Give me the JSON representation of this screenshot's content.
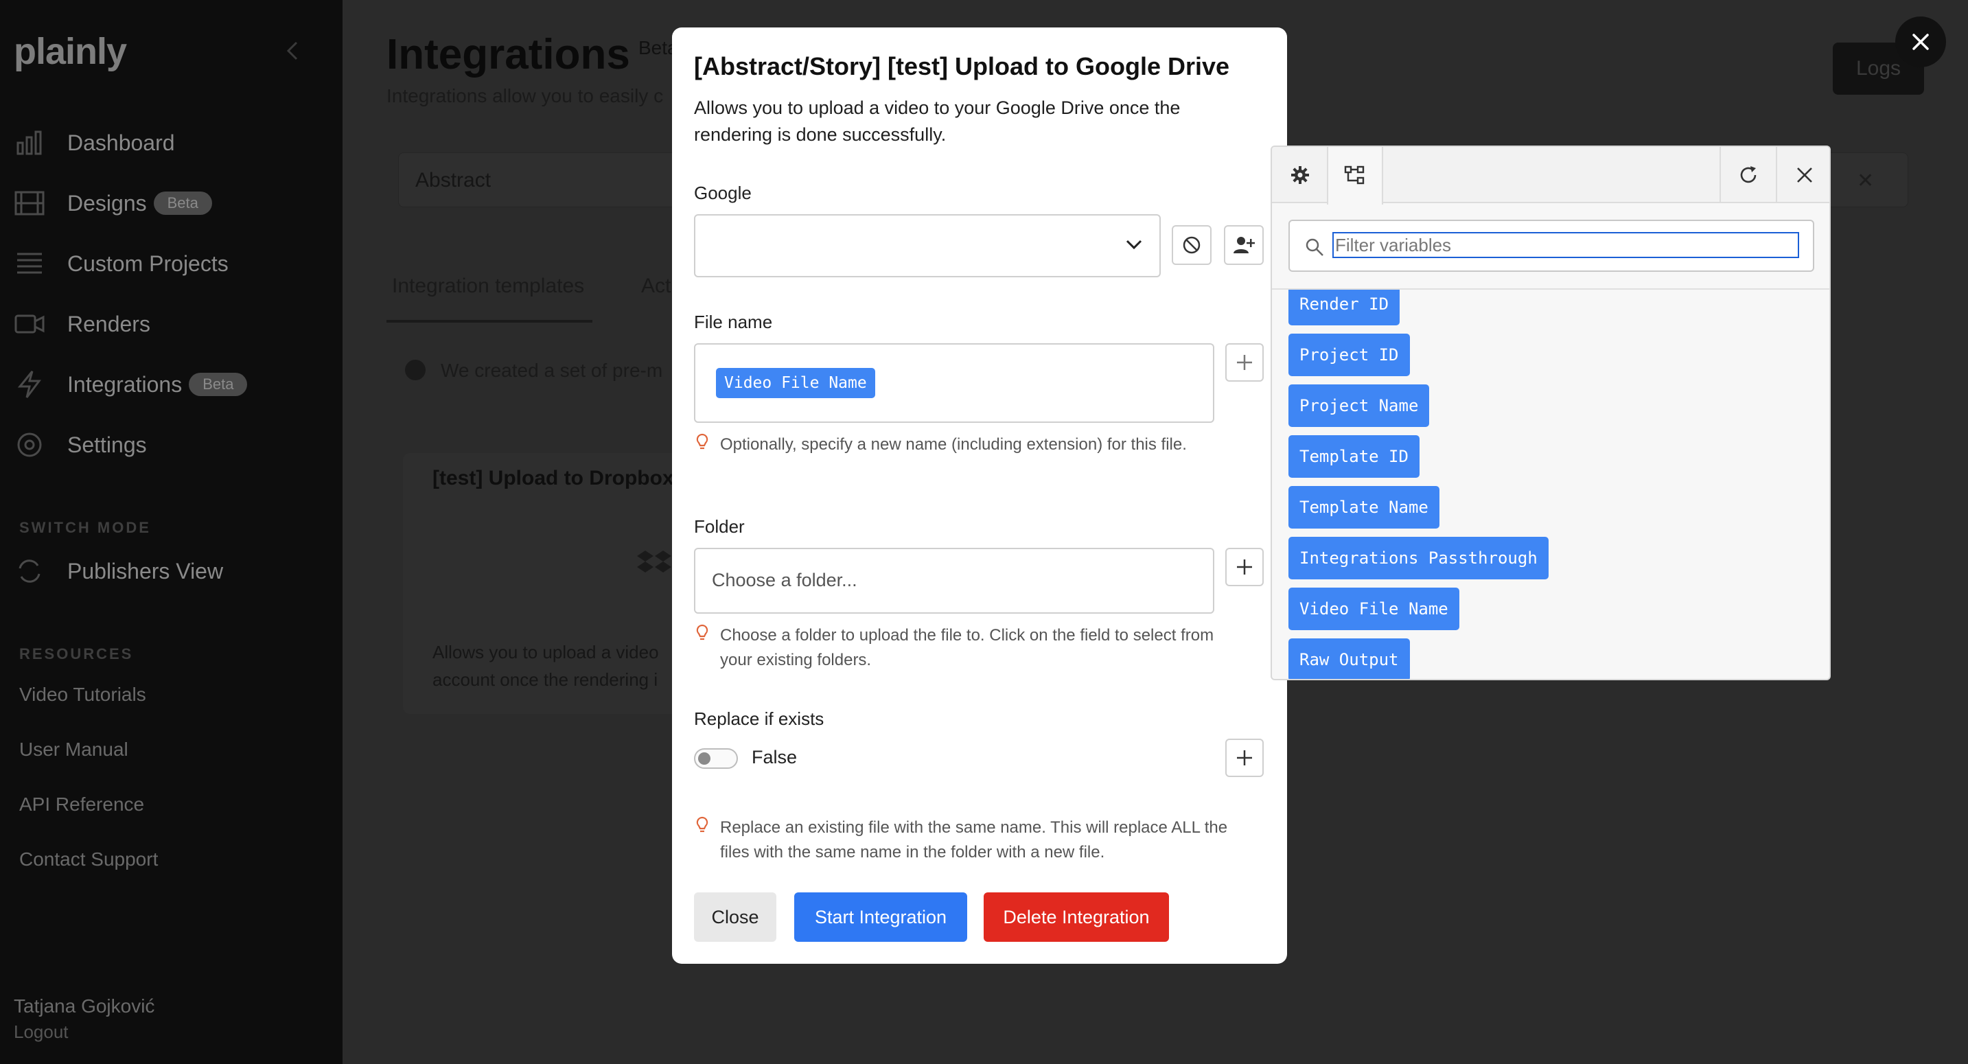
{
  "sidebar": {
    "logo": "plainly",
    "nav": [
      {
        "label": "Dashboard",
        "badge": "",
        "icon": "bar-chart-icon"
      },
      {
        "label": "Designs",
        "badge": "Beta",
        "icon": "film-icon"
      },
      {
        "label": "Custom Projects",
        "badge": "",
        "icon": "list-icon"
      },
      {
        "label": "Renders",
        "badge": "",
        "icon": "video-icon"
      },
      {
        "label": "Integrations",
        "badge": "Beta",
        "icon": "lightning-icon"
      },
      {
        "label": "Settings",
        "badge": "",
        "icon": "gear-icon"
      }
    ],
    "switch_mode_label": "SWITCH MODE",
    "publishers_view": "Publishers View",
    "resources_label": "RESOURCES",
    "resources": [
      "Video Tutorials",
      "User Manual",
      "API Reference",
      "Contact Support"
    ],
    "user_name": "Tatjana Gojković",
    "logout": "Logout"
  },
  "page": {
    "title": "Integrations",
    "beta": "Beta",
    "description": "Integrations allow you to easily c",
    "logs_label": "Logs",
    "filter_value": "Abstract",
    "filter_clear": "✕",
    "tabs": [
      "Integration templates",
      "Act"
    ],
    "info_text": "We created a set of pre-m",
    "card_title": "[test] Upload to Dropbox",
    "card_desc": "Allows you to upload a video account once the rendering i"
  },
  "modal": {
    "title": "[Abstract/Story] [test] Upload to Google Drive",
    "description": "Allows you to upload a video to your Google Drive once the rendering is done successfully.",
    "google_label": "Google",
    "google_value": "",
    "file_name_label": "File name",
    "file_name_chip": "Video File Name",
    "file_name_hint": "Optionally, specify a new name (including extension) for this file.",
    "folder_label": "Folder",
    "folder_placeholder": "Choose a folder...",
    "folder_hint": "Choose a folder to upload the file to. Click on the field to select from your existing folders.",
    "replace_label": "Replace if exists",
    "replace_value": "False",
    "replace_hint": "Replace an existing file with the same name. This will replace ALL the files with the same name in the folder with a new file.",
    "close_label": "Close",
    "start_label": "Start Integration",
    "delete_label": "Delete Integration"
  },
  "popover": {
    "search_placeholder": "Filter variables",
    "variables": [
      "Render ID",
      "Project ID",
      "Project Name",
      "Template ID",
      "Template Name",
      "Integrations Passthrough",
      "Video File Name",
      "Raw Output"
    ]
  },
  "colors": {
    "primary": "#2f78f3",
    "chip": "#3f86f4",
    "danger": "#e1291f",
    "hint_icon": "#e0653a"
  }
}
